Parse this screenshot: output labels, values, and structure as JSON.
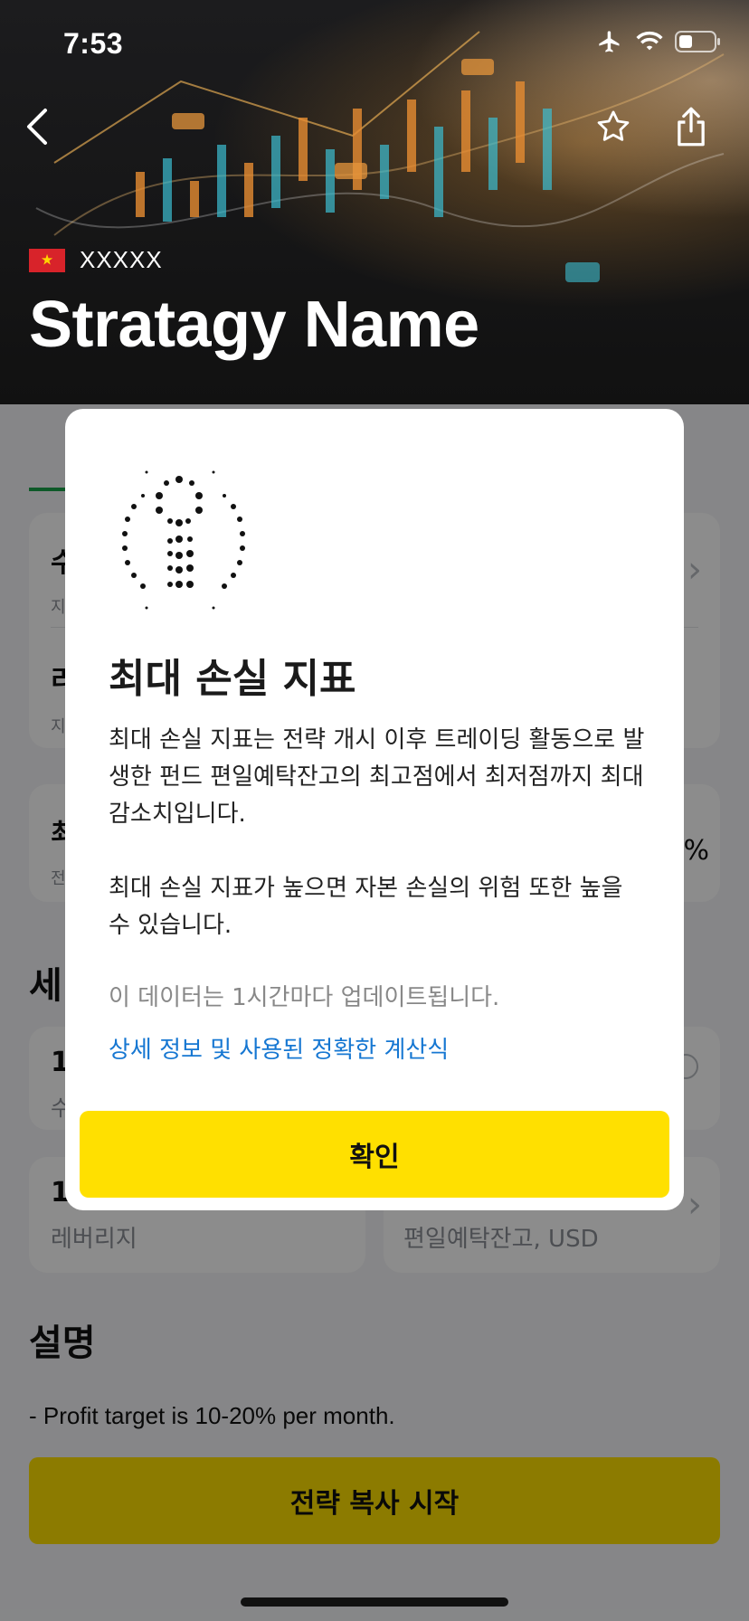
{
  "status_bar": {
    "time": "7:53"
  },
  "hero": {
    "country_name": "XXXXX",
    "strategy_name": "Stratagy Name"
  },
  "page": {
    "card_leverage_sub": "레버리지",
    "card_balance_sub": "편일예탁잔고, USD",
    "section_description": "설명",
    "description_line": "- Profit target is 10-20% per month.",
    "cta_label": "전략 복사 시작"
  },
  "dialog": {
    "title": "최대 손실 지표",
    "body_p1": "최대 손실 지표는 전략 개시 이후 트레이딩 활동으로 발생한 펀드 편일예탁잔고의 최고점에서 최저점까지 최대 감소치입니다.",
    "body_p2": "최대 손실 지표가 높으면 자본 손실의 위험 또한 높을 수 있습니다.",
    "note": "이 데이터는 1시간마다 업데이트됩니다.",
    "link": "상세 정보 및 사용된 정확한 계산식",
    "confirm_label": "확인"
  }
}
